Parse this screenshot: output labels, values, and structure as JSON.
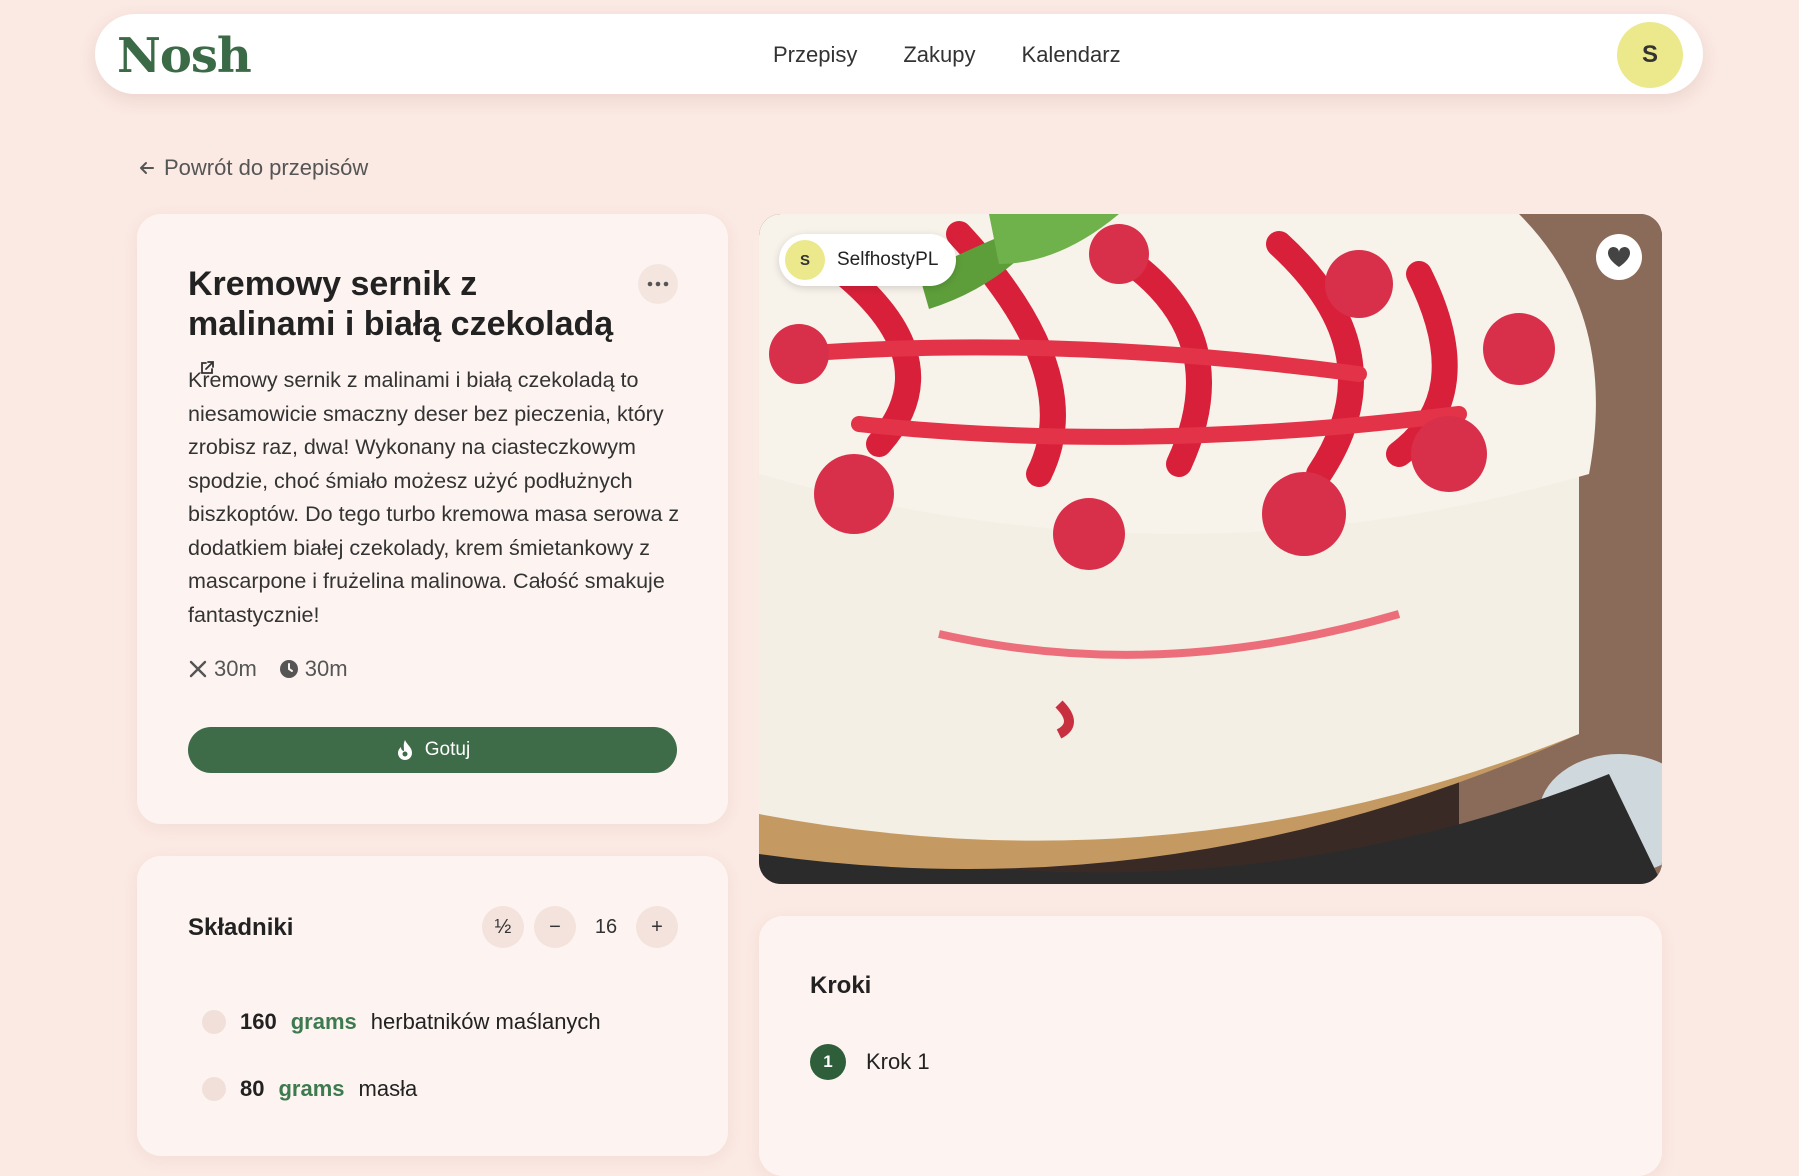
{
  "app": {
    "logo": "Nosh"
  },
  "nav": {
    "items": [
      "Przepisy",
      "Zakupy",
      "Kalendarz"
    ]
  },
  "user": {
    "initial": "S"
  },
  "back_link": "Powrót do przepisów",
  "recipe": {
    "title": "Kremowy sernik z malinami i białą czekoladą",
    "description": "Kremowy sernik z malinami i białą czekoladą to niesamowicie smaczny deser bez pieczenia, który zrobisz raz, dwa! Wykonany na ciasteczkowym spodzie, choć śmiało możesz użyć podłużnych biszkoptów. Do tego turbo kremowa masa serowa z dodatkiem białej czekolady, krem śmietankowy z mascarpone i frużelina malinowa. Całość smakuje fantastycznie!",
    "prep_time": "30m",
    "total_time": "30m",
    "cook_label": "Gotuj",
    "author": {
      "initial": "S",
      "name": "SelfhostyPL"
    }
  },
  "ingredients": {
    "title": "Składniki",
    "half_label": "½",
    "minus_label": "−",
    "plus_label": "+",
    "servings": "16",
    "items": [
      {
        "qty": "160",
        "unit": "grams",
        "name": "herbatników maślanych"
      },
      {
        "qty": "80",
        "unit": "grams",
        "name": "masła"
      }
    ]
  },
  "steps": {
    "title": "Kroki",
    "items": [
      {
        "num": "1",
        "label": "Krok 1"
      }
    ]
  },
  "colors": {
    "accent": "#3e6b48",
    "background": "#fbe9e3",
    "avatar": "#ece98d"
  },
  "icons": {
    "back": "arrow-left-icon",
    "menu": "more-dots-icon",
    "external": "external-link-icon",
    "prep": "utensils-icon",
    "time": "clock-icon",
    "cook": "flame-icon",
    "favorite": "heart-icon"
  }
}
